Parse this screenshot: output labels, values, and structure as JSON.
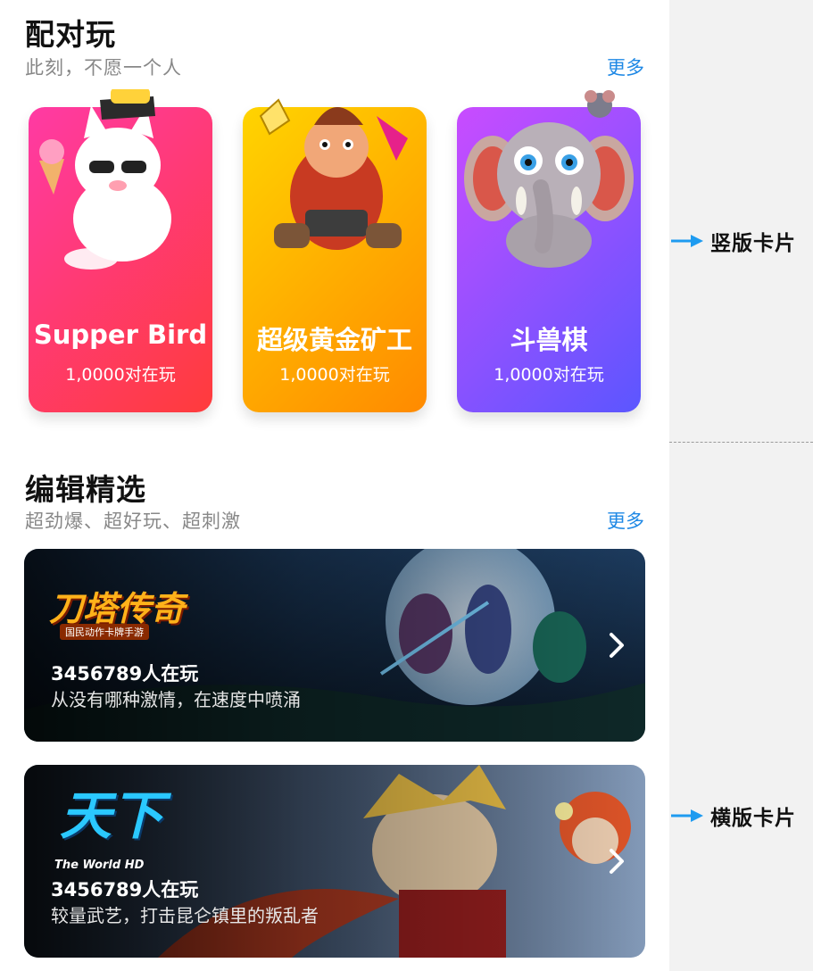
{
  "sections": {
    "pair": {
      "title": "配对玩",
      "subtitle": "此刻，不愿一个人",
      "more": "更多"
    },
    "editor": {
      "title": "编辑精选",
      "subtitle": "超劲爆、超好玩、超刺激",
      "more": "更多"
    }
  },
  "vertical_cards": [
    {
      "name": "Supper Bird",
      "count": "1,0000对在玩",
      "gradient": [
        "#ff3aa4",
        "#ff3b3b"
      ],
      "icon": "cat-character-icon"
    },
    {
      "name": "超级黄金矿工",
      "count": "1,0000对在玩",
      "gradient": [
        "#ffd400",
        "#ff8a00"
      ],
      "icon": "miner-character-icon"
    },
    {
      "name": "斗兽棋",
      "count": "1,0000对在玩",
      "gradient": [
        "#c94cff",
        "#5b56ff"
      ],
      "icon": "elephant-character-icon"
    }
  ],
  "horizontal_cards": [
    {
      "logo": "刀塔传奇",
      "logo_sub": "国民动作卡牌手游",
      "count": "3456789人在玩",
      "desc": "从没有哪种激情，在速度中喷涌"
    },
    {
      "logo": "天下",
      "logo_sub": "The World HD",
      "count": "3456789人在玩",
      "desc": "较量武艺，打击昆仑镇里的叛乱者"
    }
  ],
  "annotations": {
    "vertical": "竖版卡片",
    "horizontal": "横版卡片"
  },
  "colors": {
    "link": "#1e88e5",
    "annotation_arrow": "#1e9bf0"
  }
}
